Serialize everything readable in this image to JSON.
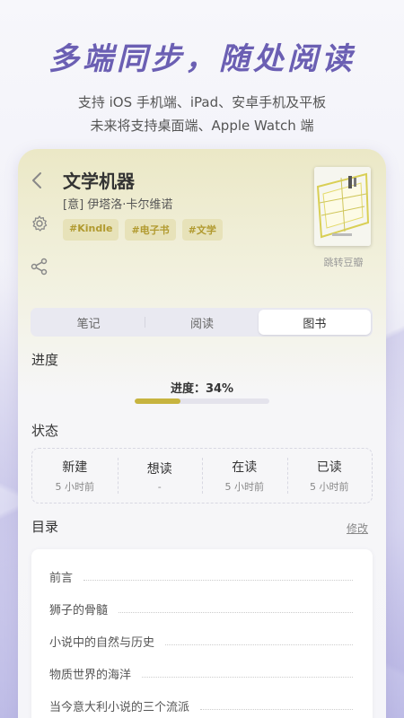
{
  "promo": {
    "title": "多端同步，随处阅读",
    "line1": "支持 iOS 手机端、iPad、安卓手机及平板",
    "line2": "未来将支持桌面端、Apple Watch 端"
  },
  "book": {
    "title": "文学机器",
    "author": "[意] 伊塔洛·卡尔维诺",
    "tags": [
      "#Kindle",
      "#电子书",
      "#文学"
    ],
    "cover_link": "跳转豆瓣"
  },
  "tabs": [
    {
      "label": "笔记",
      "active": false
    },
    {
      "label": "阅读",
      "active": false
    },
    {
      "label": "图书",
      "active": true
    }
  ],
  "progress": {
    "section": "进度",
    "text": "进度：34%",
    "value": 0.34
  },
  "status": {
    "section": "状态",
    "items": [
      {
        "name": "新建",
        "time": "5 小时前"
      },
      {
        "name": "想读",
        "time": "-"
      },
      {
        "name": "在读",
        "time": "5 小时前"
      },
      {
        "name": "已读",
        "time": "5 小时前"
      }
    ]
  },
  "toc": {
    "section": "目录",
    "edit": "修改",
    "items": [
      "前言",
      "狮子的骨髓",
      "小说中的自然与历史",
      "物质世界的海洋",
      "当今意大利小说的三个流派"
    ]
  },
  "colors": {
    "accent": "#6b5fb3",
    "tag_text": "#b19a2f",
    "tag_bg": "#e7e2b9",
    "progress_fill": "#c7b43f"
  }
}
